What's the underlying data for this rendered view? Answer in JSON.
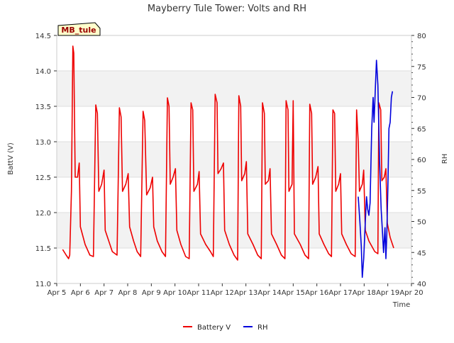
{
  "chart_data": {
    "type": "line",
    "title": "Mayberry Tule Tower: Volts and RH",
    "badge": "MB_tule",
    "xlabel": "Time",
    "ylabel_left": "BattV (V)",
    "ylabel_right": "RH",
    "x_ticks": [
      "Apr 5",
      "Apr 6",
      "Apr 7",
      "Apr 8",
      "Apr 9",
      "Apr 10",
      "Apr 11",
      "Apr 12",
      "Apr 13",
      "Apr 14",
      "Apr 15",
      "Apr 16",
      "Apr 17",
      "Apr 18",
      "Apr 19",
      "Apr 20"
    ],
    "x_range_days": [
      5,
      20
    ],
    "ylim_left": [
      11.0,
      14.5
    ],
    "yticks_left": [
      "11.0",
      "11.5",
      "12.0",
      "12.5",
      "13.0",
      "13.5",
      "14.0",
      "14.5"
    ],
    "ylim_right": [
      40,
      80
    ],
    "yticks_right": [
      "40",
      "45",
      "50",
      "55",
      "60",
      "65",
      "70",
      "75",
      "80"
    ],
    "grid": "horizontal bands",
    "legend_position": "bottom-center",
    "series": [
      {
        "name": "Battery V",
        "axis": "left",
        "color": "#ee0000",
        "points": [
          [
            5.25,
            11.48
          ],
          [
            5.4,
            11.4
          ],
          [
            5.5,
            11.35
          ],
          [
            5.55,
            11.4
          ],
          [
            5.62,
            12.3
          ],
          [
            5.68,
            14.35
          ],
          [
            5.72,
            14.25
          ],
          [
            5.78,
            12.5
          ],
          [
            5.88,
            12.5
          ],
          [
            5.95,
            12.7
          ],
          [
            6.0,
            11.8
          ],
          [
            6.2,
            11.55
          ],
          [
            6.4,
            11.4
          ],
          [
            6.55,
            11.38
          ],
          [
            6.65,
            13.52
          ],
          [
            6.72,
            13.4
          ],
          [
            6.78,
            12.3
          ],
          [
            6.9,
            12.4
          ],
          [
            7.0,
            12.6
          ],
          [
            7.05,
            11.75
          ],
          [
            7.2,
            11.6
          ],
          [
            7.35,
            11.45
          ],
          [
            7.55,
            11.4
          ],
          [
            7.65,
            13.48
          ],
          [
            7.72,
            13.35
          ],
          [
            7.78,
            12.3
          ],
          [
            7.92,
            12.4
          ],
          [
            8.02,
            12.55
          ],
          [
            8.08,
            11.8
          ],
          [
            8.25,
            11.6
          ],
          [
            8.4,
            11.45
          ],
          [
            8.55,
            11.38
          ],
          [
            8.65,
            13.43
          ],
          [
            8.72,
            13.3
          ],
          [
            8.8,
            12.25
          ],
          [
            8.95,
            12.35
          ],
          [
            9.05,
            12.5
          ],
          [
            9.1,
            11.8
          ],
          [
            9.25,
            11.6
          ],
          [
            9.45,
            11.45
          ],
          [
            9.6,
            11.38
          ],
          [
            9.68,
            13.62
          ],
          [
            9.75,
            13.5
          ],
          [
            9.8,
            12.4
          ],
          [
            9.92,
            12.5
          ],
          [
            10.02,
            12.62
          ],
          [
            10.08,
            11.75
          ],
          [
            10.25,
            11.55
          ],
          [
            10.45,
            11.38
          ],
          [
            10.6,
            11.35
          ],
          [
            10.68,
            13.55
          ],
          [
            10.75,
            13.45
          ],
          [
            10.8,
            12.3
          ],
          [
            10.95,
            12.4
          ],
          [
            11.02,
            12.58
          ],
          [
            11.08,
            11.7
          ],
          [
            11.3,
            11.55
          ],
          [
            11.5,
            11.45
          ],
          [
            11.62,
            11.38
          ],
          [
            11.7,
            13.67
          ],
          [
            11.78,
            13.55
          ],
          [
            11.82,
            12.55
          ],
          [
            11.95,
            12.62
          ],
          [
            12.05,
            12.7
          ],
          [
            12.1,
            11.75
          ],
          [
            12.3,
            11.55
          ],
          [
            12.5,
            11.4
          ],
          [
            12.65,
            11.33
          ],
          [
            12.7,
            13.65
          ],
          [
            12.78,
            13.5
          ],
          [
            12.82,
            12.45
          ],
          [
            12.95,
            12.55
          ],
          [
            13.02,
            12.72
          ],
          [
            13.08,
            11.7
          ],
          [
            13.3,
            11.55
          ],
          [
            13.5,
            11.4
          ],
          [
            13.65,
            11.35
          ],
          [
            13.7,
            13.55
          ],
          [
            13.78,
            13.4
          ],
          [
            13.82,
            12.4
          ],
          [
            13.95,
            12.45
          ],
          [
            14.02,
            12.62
          ],
          [
            14.08,
            11.7
          ],
          [
            14.3,
            11.55
          ],
          [
            14.5,
            11.4
          ],
          [
            14.65,
            11.35
          ],
          [
            14.7,
            13.58
          ],
          [
            14.78,
            13.45
          ],
          [
            14.82,
            12.3
          ],
          [
            14.95,
            12.4
          ],
          [
            15.0,
            13.58
          ],
          [
            15.05,
            11.7
          ],
          [
            15.3,
            11.55
          ],
          [
            15.5,
            11.4
          ],
          [
            15.65,
            11.35
          ],
          [
            15.7,
            13.53
          ],
          [
            15.78,
            13.4
          ],
          [
            15.82,
            12.4
          ],
          [
            15.95,
            12.5
          ],
          [
            16.05,
            12.65
          ],
          [
            16.1,
            11.7
          ],
          [
            16.3,
            11.55
          ],
          [
            16.5,
            11.42
          ],
          [
            16.62,
            11.38
          ],
          [
            16.68,
            13.45
          ],
          [
            16.75,
            13.4
          ],
          [
            16.8,
            12.3
          ],
          [
            16.92,
            12.4
          ],
          [
            17.0,
            12.55
          ],
          [
            17.05,
            11.7
          ],
          [
            17.25,
            11.55
          ],
          [
            17.45,
            11.42
          ],
          [
            17.62,
            11.38
          ],
          [
            17.68,
            13.45
          ],
          [
            17.75,
            13.0
          ],
          [
            17.8,
            12.3
          ],
          [
            17.92,
            12.4
          ],
          [
            17.98,
            12.6
          ],
          [
            18.05,
            11.75
          ],
          [
            18.2,
            11.6
          ],
          [
            18.45,
            11.45
          ],
          [
            18.58,
            11.42
          ],
          [
            18.62,
            13.55
          ],
          [
            18.7,
            13.45
          ],
          [
            18.75,
            12.45
          ],
          [
            18.85,
            12.5
          ],
          [
            18.92,
            12.62
          ],
          [
            18.98,
            11.85
          ],
          [
            19.1,
            11.65
          ],
          [
            19.25,
            11.5
          ]
        ]
      },
      {
        "name": "RH",
        "axis": "right",
        "color": "#0000dd",
        "points": [
          [
            17.75,
            54
          ],
          [
            17.82,
            50
          ],
          [
            17.88,
            46
          ],
          [
            17.92,
            41
          ],
          [
            17.98,
            44
          ],
          [
            18.05,
            50
          ],
          [
            18.1,
            54
          ],
          [
            18.15,
            52
          ],
          [
            18.2,
            51
          ],
          [
            18.25,
            53
          ],
          [
            18.32,
            65
          ],
          [
            18.38,
            70
          ],
          [
            18.42,
            66
          ],
          [
            18.48,
            72
          ],
          [
            18.52,
            76
          ],
          [
            18.58,
            72
          ],
          [
            18.65,
            60
          ],
          [
            18.72,
            52
          ],
          [
            18.78,
            48
          ],
          [
            18.82,
            45
          ],
          [
            18.88,
            49
          ],
          [
            18.92,
            44
          ],
          [
            18.96,
            48
          ],
          [
            19.0,
            55
          ],
          [
            19.05,
            65
          ],
          [
            19.1,
            66
          ],
          [
            19.15,
            70
          ],
          [
            19.2,
            71
          ]
        ]
      }
    ]
  }
}
